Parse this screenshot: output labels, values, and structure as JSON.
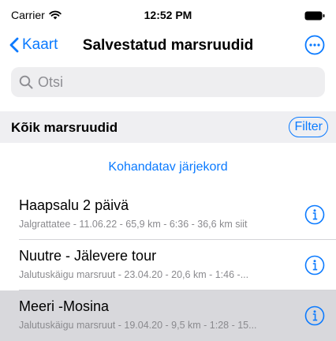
{
  "status_bar": {
    "carrier": "Carrier",
    "time": "12:52 PM"
  },
  "nav": {
    "back_label": "Kaart",
    "title": "Salvestatud marsruudid"
  },
  "search": {
    "placeholder": "Otsi"
  },
  "section": {
    "title": "Kõik marsruudid",
    "filter_label": "Filter"
  },
  "custom_order_label": "Kohandatav järjekord",
  "routes": [
    {
      "name": "Haapsalu 2 päivä",
      "details": "Jalgrattatee - 11.06.22 - 65,9 km - 6:36 - 36,6 km siit",
      "selected": false
    },
    {
      "name": "Nuutre - Jälevere tour",
      "details": "Jalutuskäigu marsruut - 23.04.20 - 20,6 km - 1:46 -...",
      "selected": false
    },
    {
      "name": "Meeri -Mosina",
      "details": "Jalutuskäigu marsruut - 19.04.20 - 9,5 km - 1:28 - 15...",
      "selected": true
    }
  ],
  "colors": {
    "accent": "#0a7aff",
    "selected_row": "#d8d8dc",
    "section_bg": "#efeff2"
  },
  "icons": {
    "back": "chevron-left-icon",
    "more": "ellipsis-circle-icon",
    "search": "magnifier-icon",
    "info": "info-circle-icon",
    "wifi": "wifi-icon",
    "battery": "battery-icon"
  }
}
